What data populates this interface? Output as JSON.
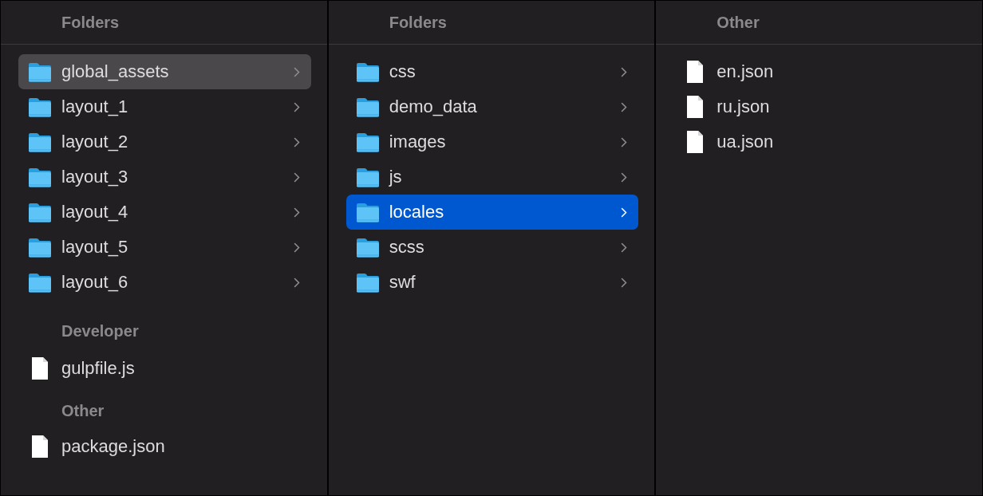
{
  "columns": [
    {
      "focused": false,
      "sections": [
        {
          "title": "Folders",
          "items": [
            {
              "name": "global_assets",
              "kind": "folder",
              "selected": true
            },
            {
              "name": "layout_1",
              "kind": "folder",
              "selected": false
            },
            {
              "name": "layout_2",
              "kind": "folder",
              "selected": false
            },
            {
              "name": "layout_3",
              "kind": "folder",
              "selected": false
            },
            {
              "name": "layout_4",
              "kind": "folder",
              "selected": false
            },
            {
              "name": "layout_5",
              "kind": "folder",
              "selected": false
            },
            {
              "name": "layout_6",
              "kind": "folder",
              "selected": false
            }
          ]
        },
        {
          "title": "Developer",
          "items": [
            {
              "name": "gulpfile.js",
              "kind": "file",
              "selected": false
            }
          ]
        },
        {
          "title": "Other",
          "items": [
            {
              "name": "package.json",
              "kind": "file",
              "selected": false
            }
          ]
        }
      ]
    },
    {
      "focused": true,
      "sections": [
        {
          "title": "Folders",
          "items": [
            {
              "name": "css",
              "kind": "folder",
              "selected": false
            },
            {
              "name": "demo_data",
              "kind": "folder",
              "selected": false
            },
            {
              "name": "images",
              "kind": "folder",
              "selected": false
            },
            {
              "name": "js",
              "kind": "folder",
              "selected": false
            },
            {
              "name": "locales",
              "kind": "folder",
              "selected": true
            },
            {
              "name": "scss",
              "kind": "folder",
              "selected": false
            },
            {
              "name": "swf",
              "kind": "folder",
              "selected": false
            }
          ]
        }
      ]
    },
    {
      "sections": [
        {
          "title": "Other",
          "items": [
            {
              "name": "en.json",
              "kind": "file",
              "selected": false
            },
            {
              "name": "ru.json",
              "kind": "file",
              "selected": false
            },
            {
              "name": "ua.json",
              "kind": "file",
              "selected": false
            }
          ]
        }
      ]
    }
  ]
}
